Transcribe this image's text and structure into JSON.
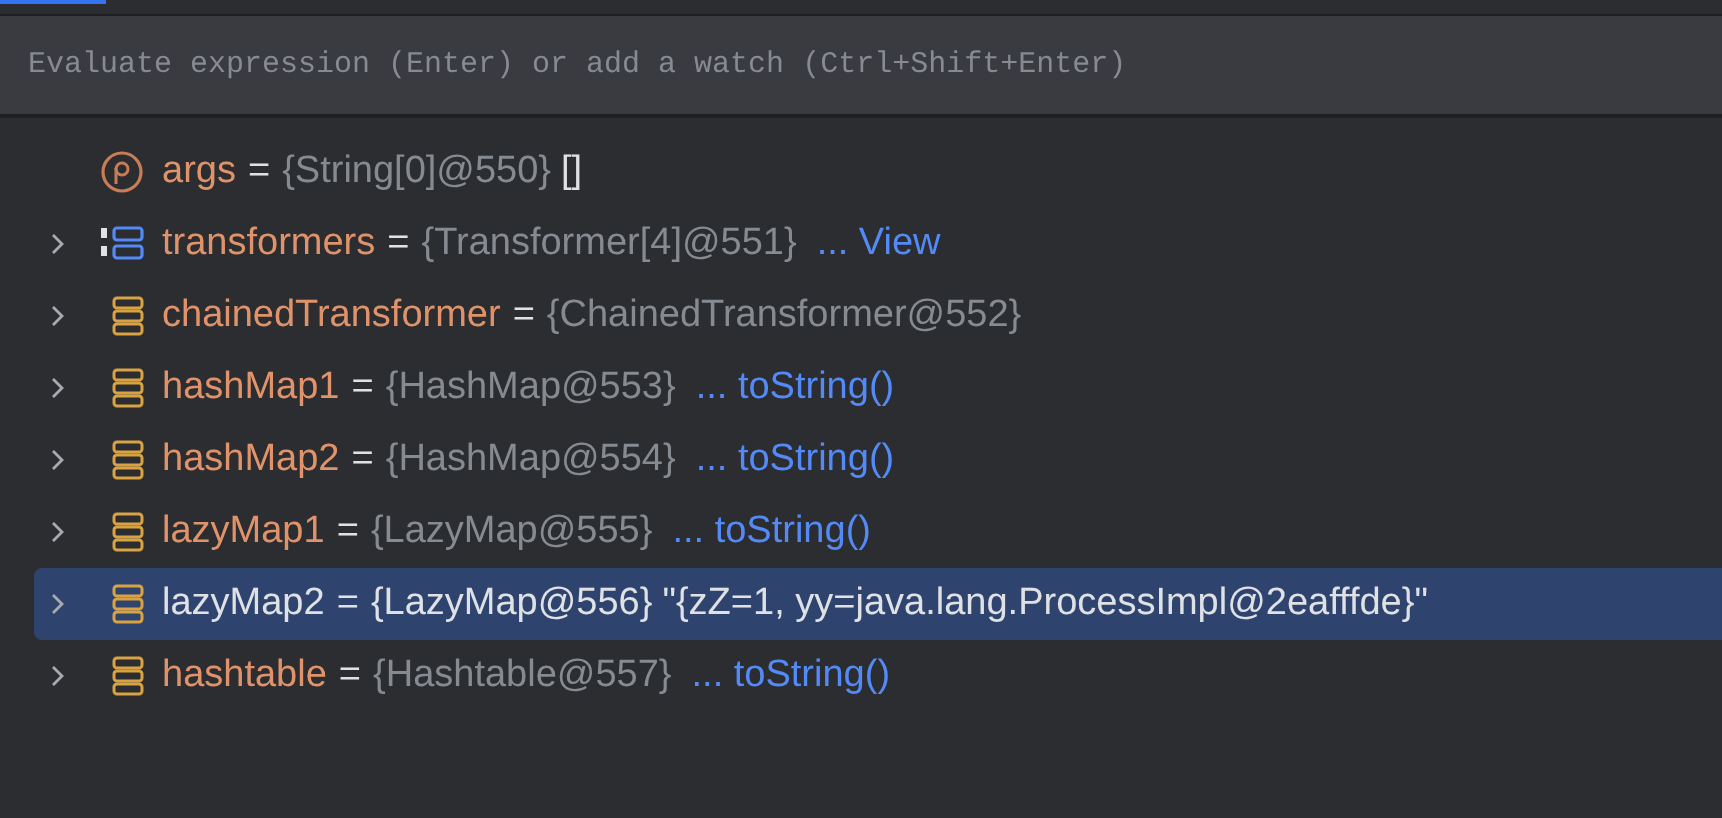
{
  "tabs": [
    {
      "selected": true
    }
  ],
  "evaluate_field": {
    "placeholder": "Evaluate expression (Enter) or add a watch (Ctrl+Shift+Enter)"
  },
  "variables": [
    {
      "kind": "param",
      "expandable": false,
      "selected": false,
      "name": "args",
      "equals": "=",
      "type_ref": "{String[0]@550}",
      "value": "[]"
    },
    {
      "kind": "array",
      "expandable": true,
      "selected": false,
      "name": "transformers",
      "equals": "=",
      "type_ref": "{Transformer[4]@551}",
      "link": "... View"
    },
    {
      "kind": "object",
      "expandable": true,
      "selected": false,
      "name": "chainedTransformer",
      "equals": "=",
      "type_ref": "{ChainedTransformer@552}"
    },
    {
      "kind": "object",
      "expandable": true,
      "selected": false,
      "name": "hashMap1",
      "equals": "=",
      "type_ref": "{HashMap@553}",
      "link": "... toString()"
    },
    {
      "kind": "object",
      "expandable": true,
      "selected": false,
      "name": "hashMap2",
      "equals": "=",
      "type_ref": "{HashMap@554}",
      "link": "... toString()"
    },
    {
      "kind": "object",
      "expandable": true,
      "selected": false,
      "name": "lazyMap1",
      "equals": "=",
      "type_ref": "{LazyMap@555}",
      "link": "... toString()"
    },
    {
      "kind": "object",
      "expandable": true,
      "selected": true,
      "name": "lazyMap2",
      "equals": "=",
      "type_ref": "{LazyMap@556}",
      "value": "\"{zZ=1, yy=java.lang.ProcessImpl@2eafffde}\""
    },
    {
      "kind": "object",
      "expandable": true,
      "selected": false,
      "name": "hashtable",
      "equals": "=",
      "type_ref": "{Hashtable@557}",
      "link": "... toString()"
    }
  ]
}
